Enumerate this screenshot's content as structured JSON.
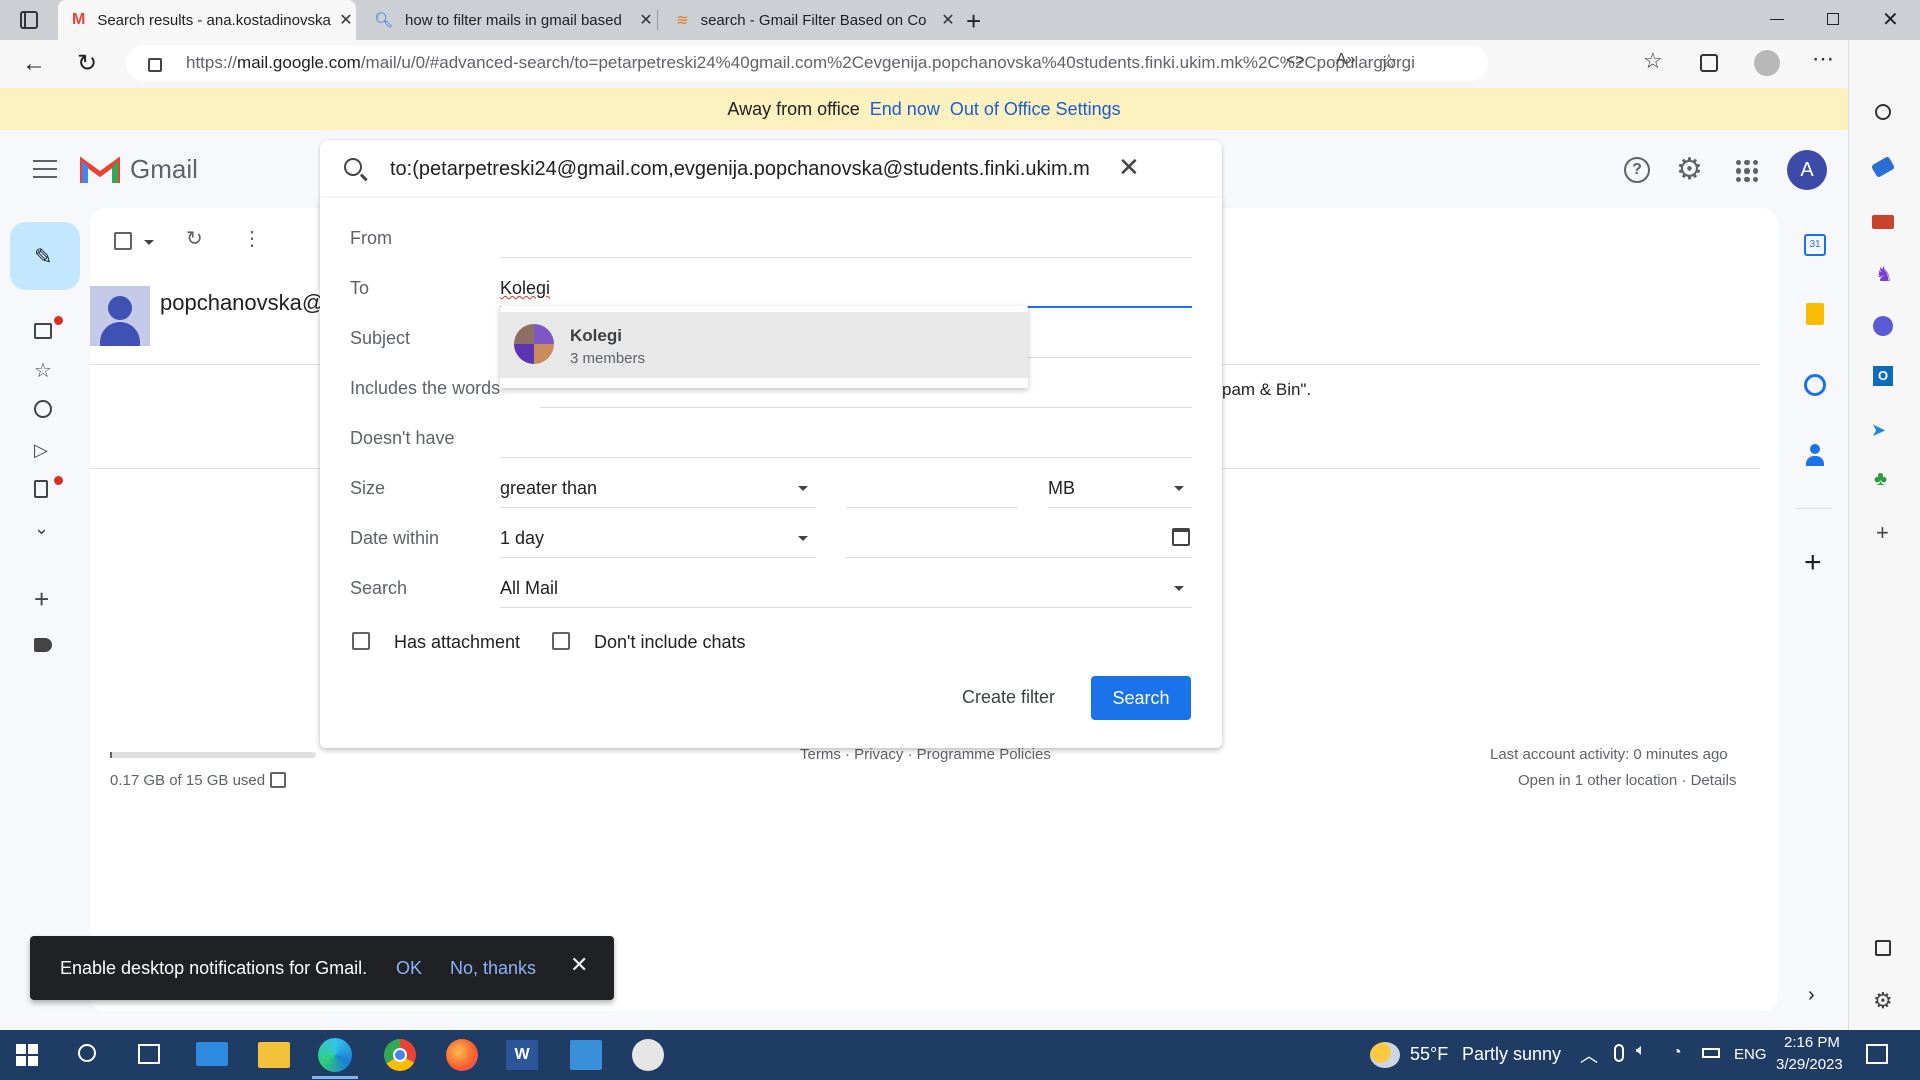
{
  "browser": {
    "tabs": [
      {
        "title": "Search results - ana.kostadinovska",
        "active": true
      },
      {
        "title": "how to filter mails in gmail based",
        "active": false
      },
      {
        "title": "search - Gmail Filter Based on Co",
        "active": false
      }
    ],
    "url_prefix": "https://",
    "url_host": "mail.google.com",
    "url_path": "/mail/u/0/#advanced-search/to=petarpetreski24%40gmail.com%2Cevgenija.popchanovska%40students.finki.ukim.mk%2C%2Cpopulargjorgi..."
  },
  "banner": {
    "text": "Away from office",
    "end_now": "End now",
    "settings": "Out of Office Settings"
  },
  "gmail": {
    "logo_text": "Gmail",
    "avatar_letter": "A",
    "search_query": "to:(petarpetreski24@gmail.com,evgenija.popchanovska@students.finki.ukim.m",
    "sender_fragment": "popchanovska@",
    "snippet_fragment": "pam & Bin\".",
    "storage": "0.17 GB of 15 GB used",
    "footer_links": "Terms · Privacy · Programme Policies",
    "last_activity": "Last account activity: 0 minutes ago",
    "other_location": "Open in 1 other location · Details"
  },
  "advanced_search": {
    "labels": {
      "from": "From",
      "to": "To",
      "subject": "Subject",
      "includes": "Includes the words",
      "doesnt_have": "Doesn't have",
      "size": "Size",
      "date_within": "Date within",
      "search": "Search"
    },
    "to_value": "Kolegi",
    "size_operator": "greater than",
    "size_unit": "MB",
    "date_within": "1 day",
    "search_in": "All Mail",
    "has_attachment": "Has attachment",
    "dont_include_chats": "Don't include chats",
    "create_filter": "Create filter",
    "search_button": "Search",
    "suggestion": {
      "name": "Kolegi",
      "members": "3 members"
    }
  },
  "notification": {
    "text": "Enable desktop notifications for Gmail.",
    "ok": "OK",
    "no_thanks": "No, thanks"
  },
  "taskbar": {
    "weather_temp": "55°F",
    "weather_text": "Partly sunny",
    "lang": "ENG",
    "time": "2:16 PM",
    "date": "3/29/2023"
  },
  "colors": {
    "accent": "#1a73e8",
    "banner": "#fdf1c0",
    "taskbar": "#1f3d64",
    "avatar": "#3c4ba8"
  }
}
